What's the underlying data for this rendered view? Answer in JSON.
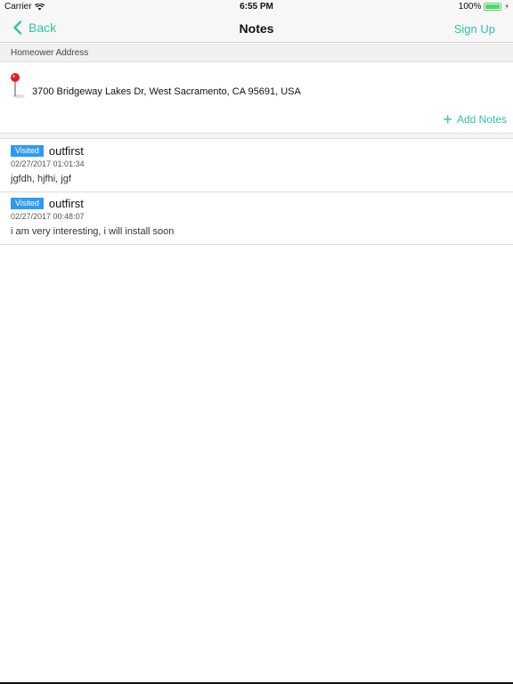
{
  "status_bar": {
    "carrier": "Carrier",
    "time": "6:55 PM",
    "battery": "100%"
  },
  "nav": {
    "back_label": "Back",
    "title": "Notes",
    "signup_label": "Sign Up"
  },
  "section": {
    "header": "Homeower Address"
  },
  "address": {
    "text": "3700 Bridgeway Lakes Dr, West Sacramento, CA 95691, USA",
    "add_notes_label": "Add Notes"
  },
  "notes": [
    {
      "badge": "Visited",
      "author": "outfirst",
      "date": "02/27/2017 01:01:34",
      "body": "jgfdh, hjfhi, jgf"
    },
    {
      "badge": "Visited",
      "author": "outfirst",
      "date": "02/27/2017 00:48:07",
      "body": "i am very interesting, i will install soon"
    }
  ],
  "colors": {
    "accent": "#2ec4a6",
    "badge": "#2f9bf0",
    "battery": "#4cd964"
  },
  "icons": {
    "back": "chevron-left-icon",
    "add": "plus-icon",
    "location": "map-pin-icon",
    "wifi": "wifi-icon",
    "battery": "battery-icon"
  }
}
